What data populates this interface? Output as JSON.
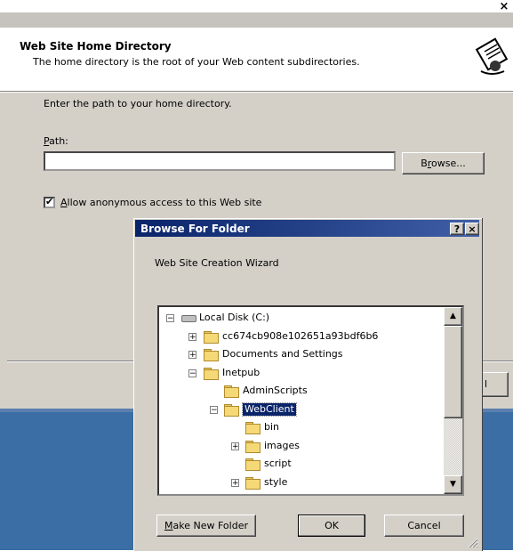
{
  "wizard": {
    "title": "Web Site Creation Wizard",
    "close_glyph": "×",
    "header_title": "Web Site Home Directory",
    "header_subtitle": "The home directory is the root of your Web content subdirectories.",
    "prompt": "Enter the path to your home directory.",
    "path_label_accel": "P",
    "path_label_rest": "ath:",
    "path_value": "",
    "browse_pre": "B",
    "browse_accel": "r",
    "browse_post": "owse...",
    "anonymous_checked": true,
    "anonymous_accel": "A",
    "anonymous_rest": "llow anonymous access to this Web site",
    "check_glyph": "✔",
    "partial_button_char": "l"
  },
  "browse_dialog": {
    "title": "Browse For Folder",
    "help_glyph": "?",
    "close_glyph": "×",
    "description": "Web Site Creation Wizard",
    "tree": [
      {
        "label": "Local Disk (C:)",
        "level": 0,
        "expander": "−",
        "icon": "drive-icon"
      },
      {
        "label": "cc674cb908e102651a93bdf6b6",
        "level": 1,
        "expander": "+",
        "icon": "folder-icon"
      },
      {
        "label": "Documents and Settings",
        "level": 1,
        "expander": "+",
        "icon": "folder-icon"
      },
      {
        "label": "Inetpub",
        "level": 1,
        "expander": "−",
        "icon": "folder-icon"
      },
      {
        "label": "AdminScripts",
        "level": 2,
        "expander": "",
        "icon": "folder-icon"
      },
      {
        "label": "WebClient",
        "level": 2,
        "expander": "−",
        "icon": "open-folder-icon",
        "selected": true
      },
      {
        "label": "bin",
        "level": 3,
        "expander": "",
        "icon": "folder-icon"
      },
      {
        "label": "images",
        "level": 3,
        "expander": "+",
        "icon": "folder-icon"
      },
      {
        "label": "script",
        "level": 3,
        "expander": "",
        "icon": "folder-icon"
      },
      {
        "label": "style",
        "level": 3,
        "expander": "+",
        "icon": "folder-icon"
      }
    ],
    "scroll_up_glyph": "▲",
    "scroll_down_glyph": "▼",
    "new_folder_accel": "M",
    "new_folder_rest": "ake New Folder",
    "ok_label": "OK",
    "cancel_label": "Cancel"
  }
}
